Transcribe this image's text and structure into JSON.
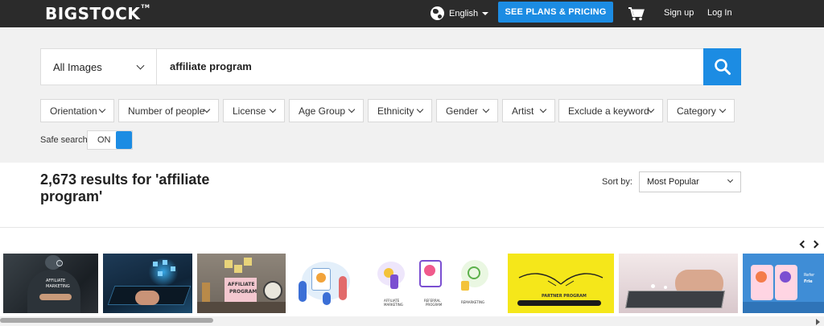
{
  "header": {
    "logo": "BIGSTOCK",
    "logo_tm": "TM",
    "language": "English",
    "plans_button": "SEE PLANS & PRICING",
    "signup": "Sign up",
    "login": "Log In"
  },
  "search": {
    "scope": "All Images",
    "query": "affiliate program"
  },
  "filters": [
    "Orientation",
    "Number of people",
    "License",
    "Age Group",
    "Ethnicity",
    "Gender",
    "Artist",
    "Exclude a keyword",
    "Category"
  ],
  "safe_search": {
    "label": "Safe search",
    "state": "ON"
  },
  "results": {
    "title": "2,673 results for 'affiliate program'",
    "sort_label": "Sort by:",
    "sort_value": "Most Popular"
  },
  "thumbnails": {
    "t1_caption": [
      "AFFILIATE",
      "MARKETING"
    ],
    "t3_caption": [
      "AFFILIATE",
      "PROGRAM"
    ],
    "t5_caption": [
      "AFFILIATE",
      "MARKETING",
      "REFERRAL",
      "PROGRAM",
      "REMARKETING"
    ],
    "t6_caption": "PARTNER PROGRAM",
    "t8_caption": [
      "Refer",
      "Frie"
    ]
  },
  "colors": {
    "accent": "#1c8ce3",
    "header_bg": "#2b2b2b",
    "search_bg": "#f1f1f1"
  },
  "icons": {
    "language": "globe-icon",
    "cart": "cart-icon",
    "search": "magnifier-icon"
  }
}
